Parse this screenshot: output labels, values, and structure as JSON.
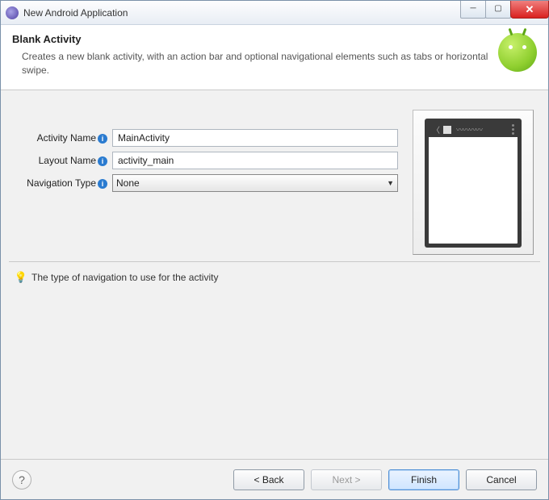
{
  "window": {
    "title": "New Android Application"
  },
  "banner": {
    "title": "Blank Activity",
    "description": "Creates a new blank activity, with an action bar and optional navigational elements such as tabs or horizontal swipe."
  },
  "form": {
    "activity_name_label": "Activity Name",
    "activity_name_value": "MainActivity",
    "layout_name_label": "Layout Name",
    "layout_name_value": "activity_main",
    "navigation_type_label": "Navigation Type",
    "navigation_type_value": "None"
  },
  "tip": {
    "text": "The type of navigation to use for the activity"
  },
  "buttons": {
    "back": "< Back",
    "next": "Next >",
    "finish": "Finish",
    "cancel": "Cancel"
  }
}
